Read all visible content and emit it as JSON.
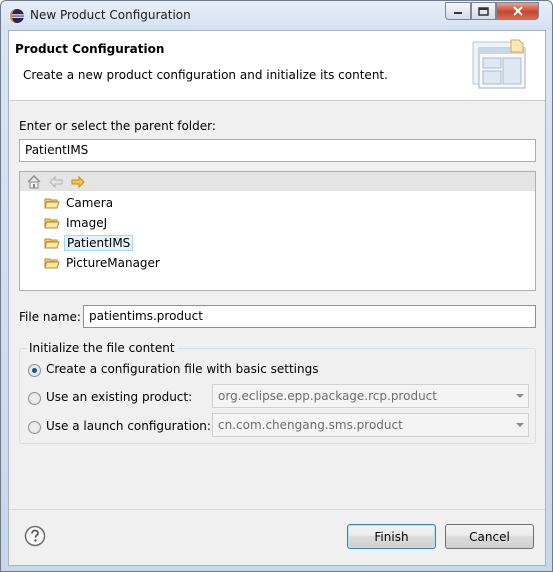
{
  "window": {
    "title": "New Product Configuration",
    "icon": "eclipse-icon"
  },
  "header": {
    "title": "Product Configuration",
    "description": "Create a new product configuration and initialize its content."
  },
  "parent_folder": {
    "label": "Enter or select the parent folder:",
    "value": "PatientIMS",
    "tree": {
      "toolbar_icons": [
        "home-icon",
        "back-arrow-icon",
        "forward-arrow-icon"
      ],
      "items": [
        {
          "label": "Camera",
          "selected": false
        },
        {
          "label": "ImageJ",
          "selected": false
        },
        {
          "label": "PatientIMS",
          "selected": true
        },
        {
          "label": "PictureManager",
          "selected": false
        }
      ]
    }
  },
  "file_name": {
    "label": "File name:",
    "value": "patientims.product"
  },
  "init_group": {
    "title": "Initialize the file content",
    "options": [
      {
        "label": "Create a configuration file with basic settings",
        "checked": true
      },
      {
        "label": "Use an existing product:",
        "checked": false,
        "combo_value": "org.eclipse.epp.package.rcp.product"
      },
      {
        "label": "Use a launch configuration:",
        "checked": false,
        "combo_value": "cn.com.chengang.sms.product"
      }
    ]
  },
  "footer": {
    "finish_label": "Finish",
    "cancel_label": "Cancel"
  },
  "colors": {
    "accent": "#3c7fb1",
    "selection": "#e5f3fb",
    "close_button": "#c7452f"
  }
}
